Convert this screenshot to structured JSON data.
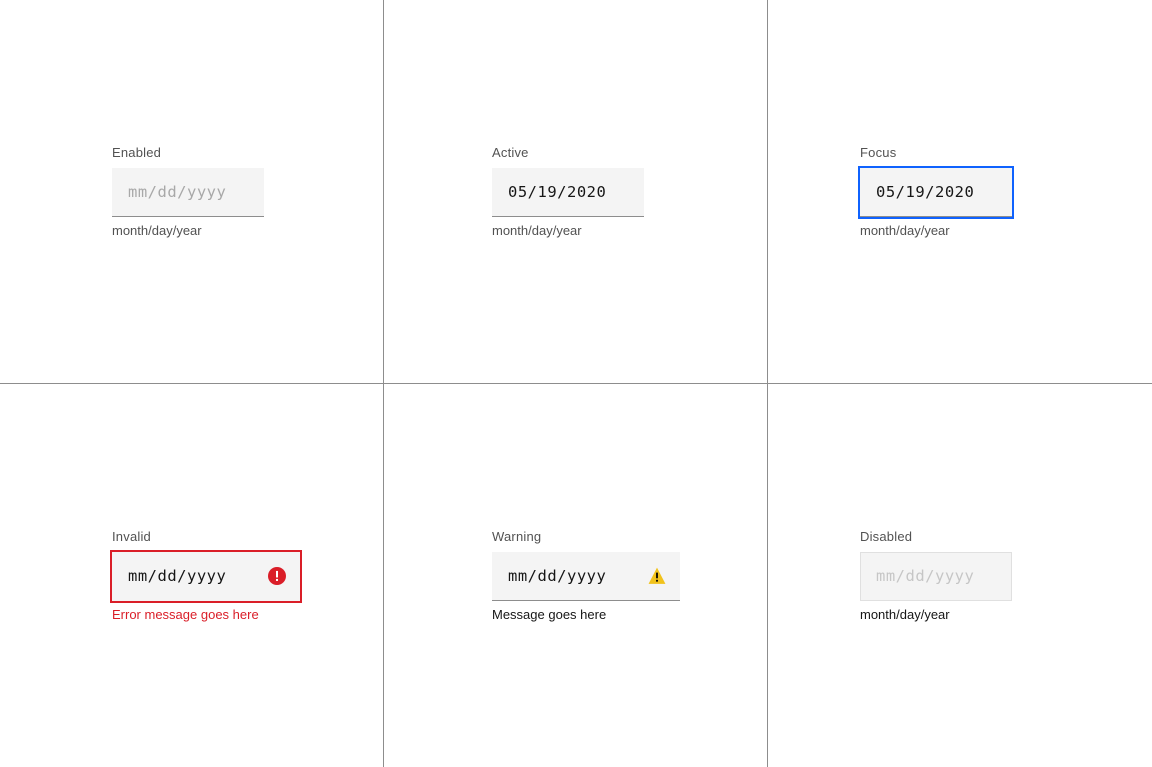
{
  "states": {
    "enabled": {
      "label": "Enabled",
      "placeholder": "mm/dd/yyyy",
      "helper": "month/day/year"
    },
    "active": {
      "label": "Active",
      "value": "05/19/2020",
      "helper": "month/day/year"
    },
    "focus": {
      "label": "Focus",
      "value": "05/19/2020",
      "helper": "month/day/year"
    },
    "invalid": {
      "label": "Invalid",
      "placeholder": "mm/dd/yyyy",
      "helper": "Error message goes here"
    },
    "warning": {
      "label": "Warning",
      "placeholder": "mm/dd/yyyy",
      "helper": "Message goes here"
    },
    "disabled": {
      "label": "Disabled",
      "placeholder": "mm/dd/yyyy",
      "helper": "month/day/year"
    }
  },
  "colors": {
    "error": "#da1e28",
    "focus": "#0f62fe",
    "warning": "#f1c21b"
  }
}
